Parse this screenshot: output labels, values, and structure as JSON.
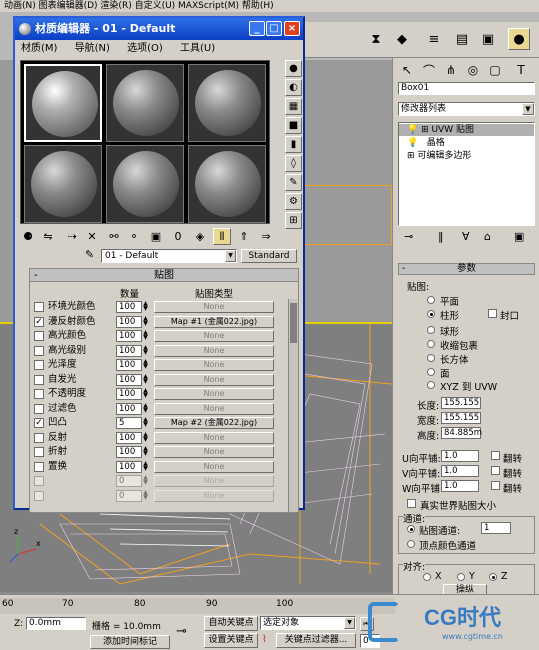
{
  "top_menu": "动画(N)   图表编辑器(D)   渲染(R)   自定义(U)   MAXScript(M)   帮助(H)",
  "material_editor": {
    "title": "材质编辑器 - 01 - Default",
    "menus": [
      "材质(M)",
      "导航(N)",
      "选项(O)",
      "工具(U)"
    ],
    "material_name": "01 - Default",
    "material_type": "Standard",
    "rollout_title": "贴图",
    "col_amount": "数量",
    "col_maptype": "贴图类型",
    "maps": [
      {
        "label": "环境光颜色",
        "checked": false,
        "amount": "100",
        "map": "None"
      },
      {
        "label": "漫反射颜色",
        "checked": true,
        "amount": "100",
        "map": "Map #1 (金属022.jpg)"
      },
      {
        "label": "高光颜色",
        "checked": false,
        "amount": "100",
        "map": "None"
      },
      {
        "label": "高光级别",
        "checked": false,
        "amount": "100",
        "map": "None"
      },
      {
        "label": "光泽度",
        "checked": false,
        "amount": "100",
        "map": "None"
      },
      {
        "label": "自发光",
        "checked": false,
        "amount": "100",
        "map": "None"
      },
      {
        "label": "不透明度",
        "checked": false,
        "amount": "100",
        "map": "None"
      },
      {
        "label": "过滤色",
        "checked": false,
        "amount": "100",
        "map": "None"
      },
      {
        "label": "凹凸",
        "checked": true,
        "amount": "5",
        "map": "Map #2 (金属022.jpg)"
      },
      {
        "label": "反射",
        "checked": false,
        "amount": "100",
        "map": "None"
      },
      {
        "label": "折射",
        "checked": false,
        "amount": "100",
        "map": "None"
      },
      {
        "label": "置换",
        "checked": false,
        "amount": "100",
        "map": "None"
      },
      {
        "label": "",
        "checked": false,
        "amount": "0",
        "map": "None"
      },
      {
        "label": "",
        "checked": false,
        "amount": "0",
        "map": "None"
      }
    ]
  },
  "command_panel": {
    "object_name": "Box01",
    "modifier_list": "修改器列表",
    "stack": [
      "UVW 贴图",
      "晶格",
      "可编辑多边形"
    ],
    "params_title": "参数",
    "mapping_label": "贴图:",
    "mapping_types": [
      "平面",
      "柱形",
      "球形",
      "收缩包裹",
      "长方体",
      "面",
      "XYZ 到 UVW"
    ],
    "selected_mapping": "柱形",
    "cap_label": "封口",
    "length_label": "长度:",
    "length": "155.155",
    "width_label": "宽度:",
    "width": "155.155",
    "height_label": "高度:",
    "height": "84.885m",
    "u_tile_label": "U向平铺:",
    "u_tile": "1.0",
    "v_tile_label": "V向平铺:",
    "v_tile": "1.0",
    "w_tile_label": "W向平铺:",
    "w_tile": "1.0",
    "flip_label": "翻转",
    "real_world": "真实世界贴图大小",
    "channel_title": "通道:",
    "map_channel_label": "贴图通道:",
    "map_channel": "1",
    "vertex_channel_label": "顶点颜色通道",
    "align_title": "对齐:",
    "axes": [
      "X",
      "Y",
      "Z"
    ],
    "fit_button": "操纵"
  },
  "bottom": {
    "timeline_ticks": [
      "60",
      "70",
      "80",
      "90",
      "100"
    ],
    "z_label": "Z:",
    "z_value": "0.0mm",
    "grid_label": "栅格 = 10.0mm",
    "add_time_tag": "添加时间标记",
    "auto_key": "自动关键点",
    "set_key": "设置关键点",
    "selected_object": "选定对象",
    "key_filters": "关键点过滤器...",
    "frame_value": "0"
  },
  "watermark": {
    "brand": "CG时代",
    "url": "www.cgtime.cn"
  }
}
